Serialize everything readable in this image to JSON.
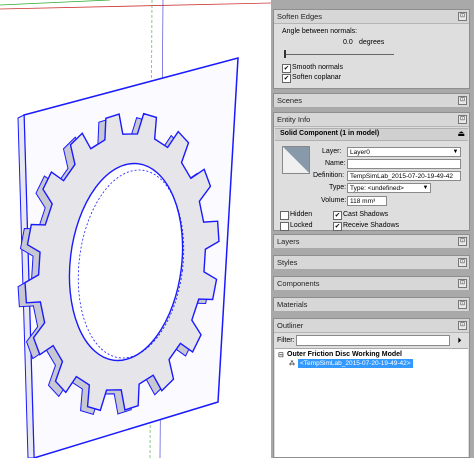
{
  "soften_edges": {
    "title": "Soften Edges",
    "angle_label": "Angle between normals:",
    "angle_value": "0.0",
    "angle_unit": "degrees",
    "smooth_normals_label": "Smooth normals",
    "smooth_normals_checked": true,
    "soften_coplanar_label": "Soften coplanar",
    "soften_coplanar_checked": true
  },
  "scenes": {
    "title": "Scenes"
  },
  "entity_info": {
    "title": "Entity Info",
    "subtitle": "Solid Component (1 in model)",
    "layer_label": "Layer:",
    "layer_value": "Layer0",
    "name_label": "Name:",
    "name_value": "",
    "definition_label": "Definition:",
    "definition_value": "TempSimLab_2015-07-20-19-49-42",
    "type_label": "Type:",
    "type_value": "Type: <undefined>",
    "volume_label": "Volume:",
    "volume_value": "118 mm³",
    "hidden_label": "Hidden",
    "locked_label": "Locked",
    "cast_shadows_label": "Cast Shadows",
    "receive_shadows_label": "Receive Shadows"
  },
  "layers": {
    "title": "Layers"
  },
  "styles": {
    "title": "Styles"
  },
  "components": {
    "title": "Components"
  },
  "materials": {
    "title": "Materials"
  },
  "outliner": {
    "title": "Outliner",
    "filter_label": "Filter:",
    "filter_value": "",
    "model_name": "Outer Friction Disc Working Model",
    "item_label": "<TempSimLab_2015-07-20-19-49-42>"
  },
  "colors": {
    "selection_blue": "#1a1aff",
    "face": "#e6e6ea",
    "tray_bg": "#a9a9a9",
    "highlight": "#3399ff"
  }
}
